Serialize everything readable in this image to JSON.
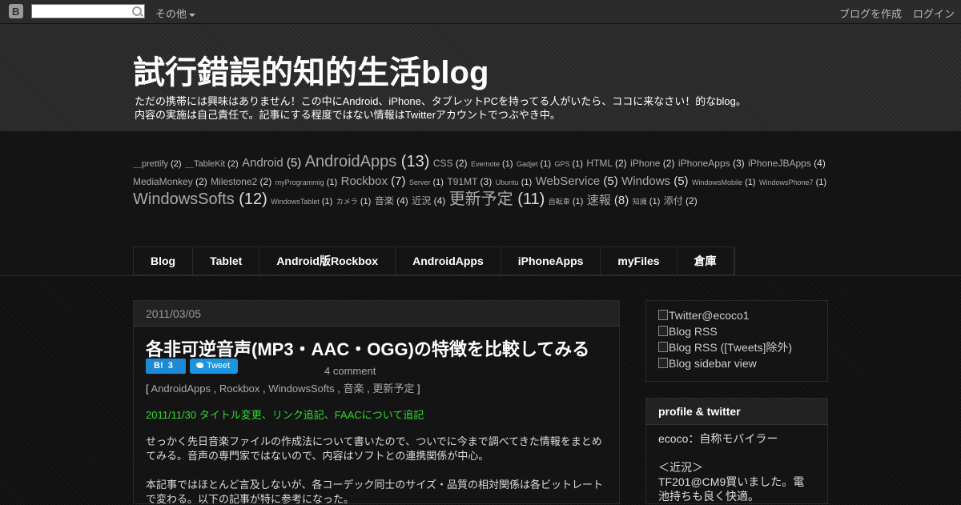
{
  "navbar": {
    "more_label": "その他",
    "create_blog": "ブログを作成",
    "login": "ログイン"
  },
  "header": {
    "title": "試行錯誤的知的生活blog",
    "desc_line1": "ただの携帯には興味はありません！この中にAndroid、iPhone、タブレットPCを持ってる人がいたら、ココに来なさい！的なblog。",
    "desc_line2": "内容の実施は自己責任で。記事にする程度ではない情報はTwitterアカウントでつぶやき中。"
  },
  "tags": [
    {
      "name": "＿prettify",
      "count": "(2)",
      "size": 2
    },
    {
      "name": "＿TableKit",
      "count": "(2)",
      "size": 2
    },
    {
      "name": "Android",
      "count": "(5)",
      "size": 4
    },
    {
      "name": "AndroidApps",
      "count": "(13)",
      "size": 5
    },
    {
      "name": "CSS",
      "count": "(2)",
      "size": 3
    },
    {
      "name": "Evernote",
      "count": "(1)",
      "size": 1
    },
    {
      "name": "Gadjet",
      "count": "(1)",
      "size": 1
    },
    {
      "name": "GPS",
      "count": "(1)",
      "size": 1
    },
    {
      "name": "HTML",
      "count": "(2)",
      "size": 3
    },
    {
      "name": "iPhone",
      "count": "(2)",
      "size": 3
    },
    {
      "name": "iPhoneApps",
      "count": "(3)",
      "size": 3
    },
    {
      "name": "iPhoneJBApps",
      "count": "(4)",
      "size": 3
    },
    {
      "name": "MediaMonkey",
      "count": "(2)",
      "size": 3
    },
    {
      "name": "Milestone2",
      "count": "(2)",
      "size": 3
    },
    {
      "name": "myProgrammig",
      "count": "(1)",
      "size": 1
    },
    {
      "name": "Rockbox",
      "count": "(7)",
      "size": 4
    },
    {
      "name": "Server",
      "count": "(1)",
      "size": 1
    },
    {
      "name": "T91MT",
      "count": "(3)",
      "size": 3
    },
    {
      "name": "Ubuntu",
      "count": "(1)",
      "size": 1
    },
    {
      "name": "WebService",
      "count": "(5)",
      "size": 4
    },
    {
      "name": "Windows",
      "count": "(5)",
      "size": 4
    },
    {
      "name": "WindowsMobile",
      "count": "(1)",
      "size": 1
    },
    {
      "name": "WindowsPhone7",
      "count": "(1)",
      "size": 1
    },
    {
      "name": "WindowsSofts",
      "count": "(12)",
      "size": 5
    },
    {
      "name": "WindowsTablet",
      "count": "(1)",
      "size": 1
    },
    {
      "name": "カメラ",
      "count": "(1)",
      "size": 1
    },
    {
      "name": "音楽",
      "count": "(4)",
      "size": 3
    },
    {
      "name": "近況",
      "count": "(4)",
      "size": 3
    },
    {
      "name": "更新予定",
      "count": "(11)",
      "size": 5
    },
    {
      "name": "自転車",
      "count": "(1)",
      "size": 1
    },
    {
      "name": "速報",
      "count": "(8)",
      "size": 4
    },
    {
      "name": "知識",
      "count": "(1)",
      "size": 1
    },
    {
      "name": "添付",
      "count": "(2)",
      "size": 3
    }
  ],
  "tabs": [
    "Blog",
    "Tablet",
    "Android版Rockbox",
    "AndroidApps",
    "iPhoneApps",
    "myFiles",
    "倉庫"
  ],
  "post": {
    "date": "2011/03/05",
    "title": "各非可逆音声(MP3・AAC・OGG)の特徴を比較してみる",
    "hatena_label": "B!",
    "hatena_count": "3",
    "tweet_label": "Tweet",
    "comments": "4 comment",
    "labels_open": "[",
    "labels_close": "]",
    "labels": [
      "AndroidApps",
      "Rockbox",
      "WindowsSofts",
      "音楽",
      "更新予定"
    ],
    "update_note": "2011/11/30 タイトル変更、リンク追記、FAACについて追記",
    "paragraph1": "せっかく先日音楽ファイルの作成法について書いたので、ついでに今まで調べてきた情報をまとめてみる。音声の専門家ではないので、内容はソフトとの連携関係が中心。",
    "paragraph2": "本記事ではほとんど言及しないが、各コーデック同士のサイズ・品質の相対関係は各ビットレートで変わる。以下の記事が特に参考になった。"
  },
  "sidebar": {
    "links": [
      "Twitter@ecoco1",
      "Blog RSS",
      "Blog RSS ([Tweets]除外)",
      "Blog sidebar view"
    ],
    "profile_title": "profile & twitter",
    "profile_line1": "ecoco：自称モバイラー",
    "profile_line2": "＜近況＞",
    "profile_line3": "TF201@CM9買いました。電池持ちも良く快適。"
  }
}
